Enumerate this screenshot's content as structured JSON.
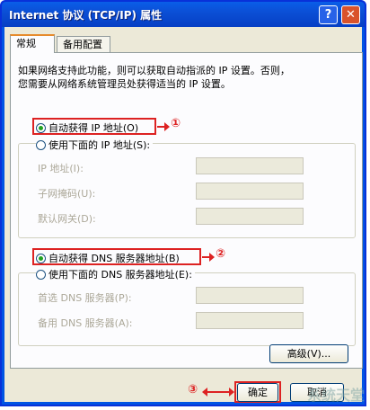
{
  "window": {
    "title": "Internet 协议 (TCP/IP) 属性",
    "help": "?",
    "close": "✕"
  },
  "tabs": [
    {
      "label": "常规"
    },
    {
      "label": "备用配置"
    }
  ],
  "desc": [
    "如果网络支持此功能，则可以获取自动指派的 IP 设置。否则，",
    "您需要从网络系统管理员处获得适当的 IP 设置。"
  ],
  "ip": {
    "auto": "自动获得 IP 地址(O)",
    "manual": "使用下面的 IP 地址(S):",
    "fields": [
      {
        "label": "IP 地址(I):"
      },
      {
        "label": "子网掩码(U):"
      },
      {
        "label": "默认网关(D):"
      }
    ]
  },
  "dns": {
    "auto": "自动获得 DNS 服务器地址(B)",
    "manual": "使用下面的 DNS 服务器地址(E):",
    "fields": [
      {
        "label": "首选 DNS 服务器(P):"
      },
      {
        "label": "备用 DNS 服务器(A):"
      }
    ]
  },
  "advanced": "高级(V)...",
  "annotations": [
    "①",
    "②",
    "③"
  ],
  "ok": "确定",
  "cancel": "取消",
  "watermark": "系统天堂"
}
